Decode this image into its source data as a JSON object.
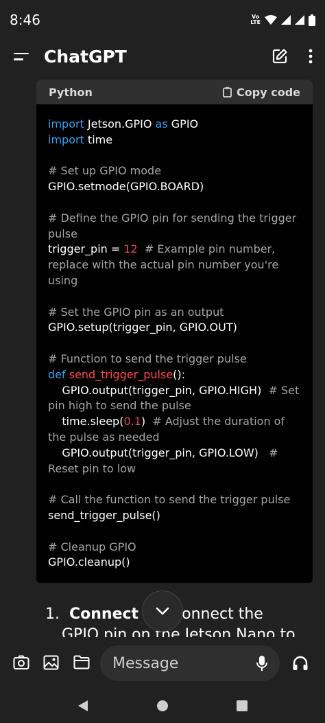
{
  "status_bar": {
    "time": "8:46",
    "network_top": "Vo LTE",
    "lte": "LTE"
  },
  "header": {
    "title": "ChatGPT"
  },
  "code_block": {
    "language": "Python",
    "copy_label": "Copy code",
    "lines": [
      [
        {
          "t": "import",
          "c": "kw"
        },
        {
          "t": " Jetson.GPIO "
        },
        {
          "t": "as",
          "c": "kw"
        },
        {
          "t": " GPIO"
        }
      ],
      [
        {
          "t": "import",
          "c": "kw"
        },
        {
          "t": " time"
        }
      ],
      [],
      [
        {
          "t": "# Set up GPIO mode",
          "c": "cm"
        }
      ],
      [
        {
          "t": "GPIO.setmode(GPIO.BOARD)"
        }
      ],
      [],
      [
        {
          "t": "# Define the GPIO pin for sending the trigger pulse",
          "c": "cm"
        }
      ],
      [
        {
          "t": "trigger_pin = "
        },
        {
          "t": "12",
          "c": "nm"
        },
        {
          "t": "  "
        },
        {
          "t": "# Example pin number, replace with the actual pin number you're using",
          "c": "cm"
        }
      ],
      [],
      [
        {
          "t": "# Set the GPIO pin as an output",
          "c": "cm"
        }
      ],
      [
        {
          "t": "GPIO.setup(trigger_pin, GPIO.OUT)"
        }
      ],
      [],
      [
        {
          "t": "# Function to send the trigger pulse",
          "c": "cm"
        }
      ],
      [
        {
          "t": "def",
          "c": "kw"
        },
        {
          "t": " "
        },
        {
          "t": "send_trigger_pulse",
          "c": "fn"
        },
        {
          "t": "():"
        }
      ],
      [
        {
          "t": "    GPIO.output(trigger_pin, GPIO.HIGH)  "
        },
        {
          "t": "# Set pin high to send the pulse",
          "c": "cm"
        }
      ],
      [
        {
          "t": "    time.sleep("
        },
        {
          "t": "0.1",
          "c": "nm"
        },
        {
          "t": ")  "
        },
        {
          "t": "# Adjust the duration of the pulse as needed",
          "c": "cm"
        }
      ],
      [
        {
          "t": "    GPIO.output(trigger_pin, GPIO.LOW)   "
        },
        {
          "t": "# Reset pin to low",
          "c": "cm"
        }
      ],
      [],
      [
        {
          "t": "# Call the function to send the trigger pulse",
          "c": "cm"
        }
      ],
      [
        {
          "t": "send_trigger_pulse()"
        }
      ],
      [],
      [
        {
          "t": "# Cleanup GPIO",
          "c": "cm"
        }
      ],
      [
        {
          "t": "GPIO.cleanup()"
        }
      ]
    ]
  },
  "list_item": {
    "number": "1.",
    "bold": "Connect to",
    "rest": ": Connect the",
    "next_line": "GPIO pin on the Jetson Nano to"
  },
  "composer": {
    "placeholder": "Message"
  }
}
